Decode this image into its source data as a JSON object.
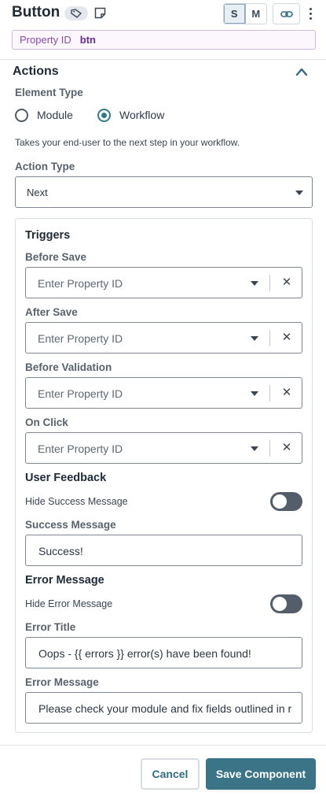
{
  "header": {
    "title": "Button",
    "tag_icon": "tag-icon",
    "note_icon": "note-icon",
    "sizes": [
      "S",
      "M"
    ],
    "active_size": "S",
    "link_icon": "link-icon",
    "more_icon": "more-vertical-icon"
  },
  "property_id": {
    "label": "Property ID",
    "value": "btn"
  },
  "actions": {
    "title": "Actions",
    "element_type_label": "Element Type",
    "options": [
      "Module",
      "Workflow"
    ],
    "selected_option": "Workflow",
    "help_text": "Takes your end-user to the next step in your workflow.",
    "action_type_label": "Action Type",
    "action_type_value": "Next"
  },
  "triggers": {
    "title": "Triggers",
    "placeholder": "Enter Property ID",
    "items": [
      {
        "label": "Before Save"
      },
      {
        "label": "After Save"
      },
      {
        "label": "Before Validation"
      },
      {
        "label": "On Click"
      }
    ]
  },
  "user_feedback": {
    "title": "User Feedback",
    "hide_success_label": "Hide Success Message",
    "hide_success_on": false,
    "success_message_label": "Success Message",
    "success_message_value": "Success!"
  },
  "error_message": {
    "title": "Error Message",
    "hide_error_label": "Hide Error Message",
    "hide_error_on": false,
    "error_title_label": "Error Title",
    "error_title_value": "Oops - {{ errors }} error(s) have been found!",
    "error_message_label": "Error Message",
    "error_message_value": "Please check your module and fix fields outlined in r"
  },
  "footer": {
    "cancel_label": "Cancel",
    "save_label": "Save Component"
  },
  "colors": {
    "accent": "#3b7487",
    "property_border": "#cfb7e0",
    "property_text": "#6a2a95",
    "toggle_off": "#545e6b"
  }
}
